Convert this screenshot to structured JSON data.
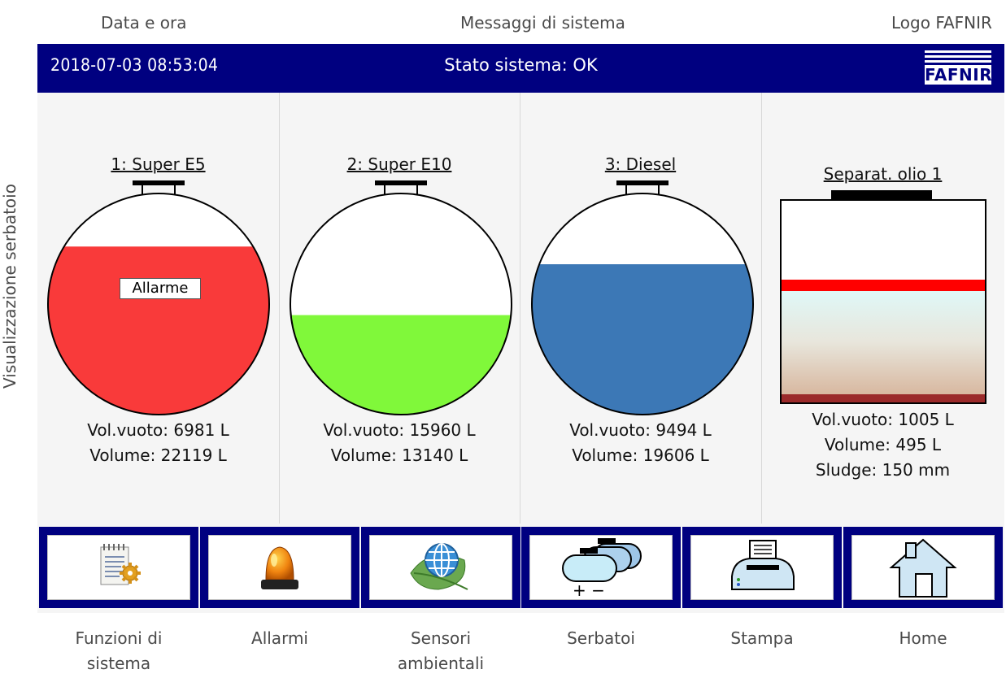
{
  "annotations": {
    "datetime": "Data e ora",
    "messages": "Messaggi di sistema",
    "logo": "Logo FAFNIR",
    "tank_view": "Visualizzazione serbatoio"
  },
  "header": {
    "datetime": "2018-07-03  08:53:04",
    "status": "Stato sistema: OK",
    "logo_text": "FAFNIR"
  },
  "colors": {
    "header_bg": "#000080",
    "tank1_fill": "#f93a3a",
    "tank2_fill": "#80f83a",
    "tank3_fill": "#3c78b6",
    "separator_red": "#ff0000",
    "separator_sludge": "#9b2a2a"
  },
  "tanks": [
    {
      "title": "1: Super E5",
      "empty": "Vol.vuoto: 6981 L",
      "volume": "Volume: 22119 L",
      "fill_fraction": 0.76,
      "alarm": "Allarme"
    },
    {
      "title": "2: Super E10",
      "empty": "Vol.vuoto: 15960 L",
      "volume": "Volume: 13140 L",
      "fill_fraction": 0.45
    },
    {
      "title": "3: Diesel",
      "empty": "Vol.vuoto: 9494 L",
      "volume": "Volume: 19606 L",
      "fill_fraction": 0.68
    }
  ],
  "separator": {
    "title": "Separat. olio 1",
    "empty": "Vol.vuoto: 1005 L",
    "volume": "Volume: 495 L",
    "sludge": "Sludge: 150 mm"
  },
  "toolbar": [
    {
      "label": "Funzioni di sistema",
      "icon": "system-functions-icon"
    },
    {
      "label": "Allarmi",
      "icon": "alarm-beacon-icon"
    },
    {
      "label": "Sensori ambientali",
      "icon": "environment-sensor-icon"
    },
    {
      "label": "Serbatoi",
      "icon": "tanks-icon"
    },
    {
      "label": "Stampa",
      "icon": "printer-icon"
    },
    {
      "label": "Home",
      "icon": "home-icon"
    }
  ]
}
